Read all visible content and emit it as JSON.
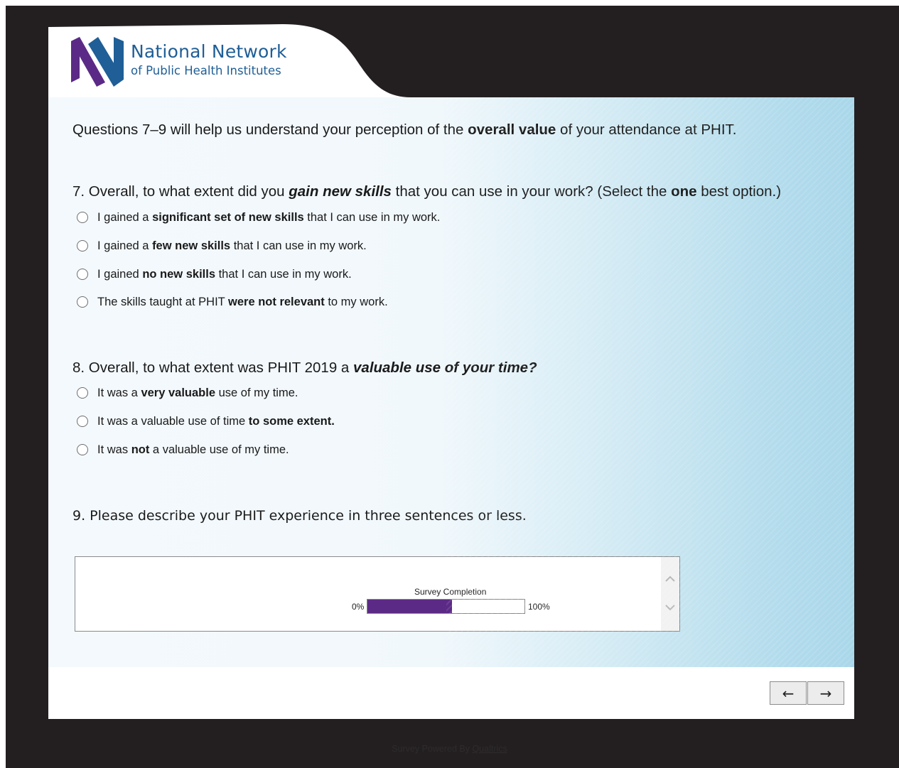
{
  "logo": {
    "line1": "National Network",
    "line2": "of Public Health Institutes",
    "colors": {
      "purple": "#5b2a86",
      "blue": "#1f5e96"
    }
  },
  "intro": {
    "prefix": "Questions 7–9 will help us understand your perception of the ",
    "bold": "overall value",
    "suffix": " of your attendance at PHIT."
  },
  "q7": {
    "prefix": "7. Overall, to what extent did you ",
    "emphasis": "gain new skills",
    "middle": " that you can use in your work? (Select the ",
    "bold": "one",
    "suffix": " best option.)",
    "options": [
      {
        "pre": "I gained a ",
        "bold": "significant set of new skills",
        "post": " that I can use in my work."
      },
      {
        "pre": "I gained a ",
        "bold": "few new skills",
        "post": " that I can use in my work."
      },
      {
        "pre": "I gained ",
        "bold": "no new skills",
        "post": " that I can use in my work."
      },
      {
        "pre": "The skills taught at PHIT ",
        "bold": "were not relevant",
        "post": " to my work."
      }
    ]
  },
  "q8": {
    "prefix": "8. Overall, to what extent was PHIT 2019 a ",
    "emphasis": "valuable use of your time?",
    "options": [
      {
        "pre": "It was a ",
        "bold": "very valuable",
        "post": " use of my time."
      },
      {
        "pre": "It was a valuable use of time ",
        "bold": "to some extent.",
        "post": ""
      },
      {
        "pre": "It was ",
        "bold": "not",
        "post": " a valuable use of my time."
      }
    ]
  },
  "q9": {
    "title": "9. Please describe your PHIT experience in three sentences or less.",
    "value": ""
  },
  "progress": {
    "label": "Survey Completion",
    "min_label": "0%",
    "max_label": "100%",
    "percent": 54,
    "fill_color": "#5b2a86"
  },
  "nav": {
    "back": "←",
    "next": "→"
  },
  "footer": {
    "prefix": "Survey Powered By ",
    "link": "Qualtrics"
  }
}
